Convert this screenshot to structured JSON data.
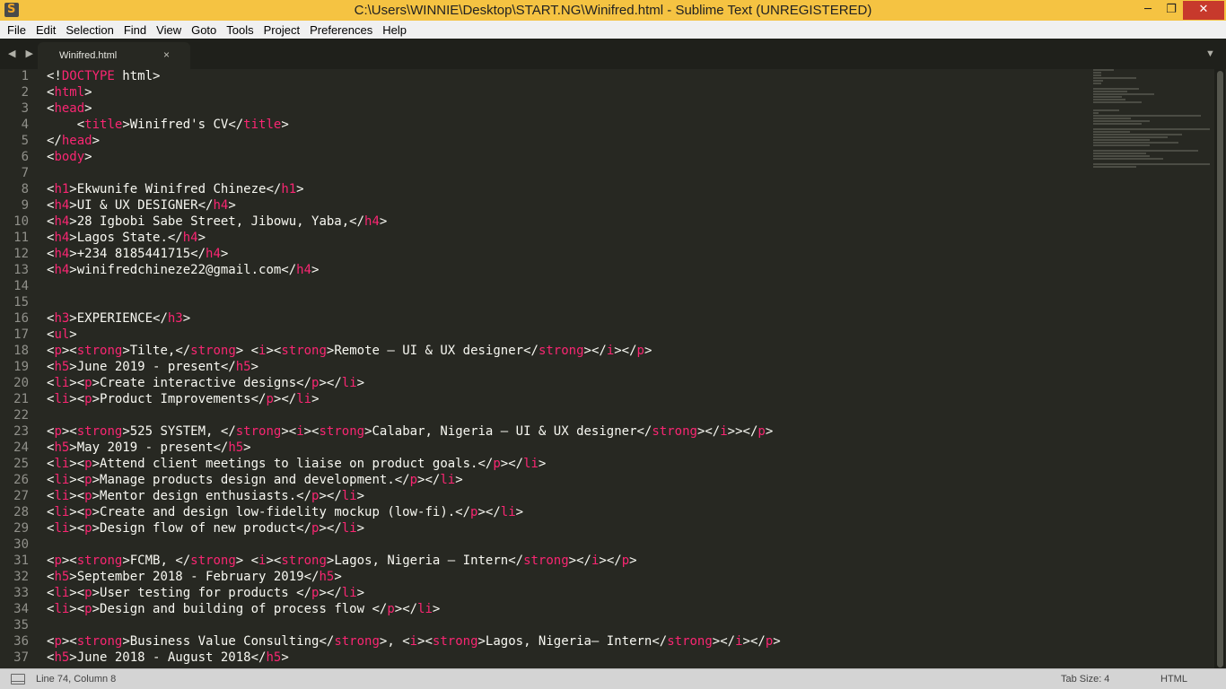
{
  "window": {
    "title": "C:\\Users\\WINNIE\\Desktop\\START.NG\\Winifred.html - Sublime Text (UNREGISTERED)",
    "minimize": "─",
    "maximize": "❐",
    "close": "✕"
  },
  "menu": [
    "File",
    "Edit",
    "Selection",
    "Find",
    "View",
    "Goto",
    "Tools",
    "Project",
    "Preferences",
    "Help"
  ],
  "tabs": {
    "nav_arrows": "◀ ▶",
    "active": "Winifred.html",
    "close": "×",
    "dropdown": "▼"
  },
  "colors": {
    "tag": "#f92672",
    "text": "#f8f8f2",
    "background": "#272822",
    "line_number": "#90908a",
    "title_bar": "#f5c342"
  },
  "editor": {
    "lines": [
      {
        "n": "1",
        "html": "&lt;!<span class=\"tag\">DOCTYPE</span> html&gt;"
      },
      {
        "n": "2",
        "html": "&lt;<span class=\"tag\">html</span>&gt;"
      },
      {
        "n": "3",
        "html": "&lt;<span class=\"tag\">head</span>&gt;"
      },
      {
        "n": "4",
        "html": "    &lt;<span class=\"tag\">title</span>&gt;Winifred's CV&lt;/<span class=\"tag\">title</span>&gt;"
      },
      {
        "n": "5",
        "html": "&lt;/<span class=\"tag\">head</span>&gt;"
      },
      {
        "n": "6",
        "html": "&lt;<span class=\"tag\">body</span>&gt;"
      },
      {
        "n": "7",
        "html": ""
      },
      {
        "n": "8",
        "html": "&lt;<span class=\"tag\">h1</span>&gt;Ekwunife Winifred Chineze&lt;/<span class=\"tag\">h1</span>&gt;"
      },
      {
        "n": "9",
        "html": "&lt;<span class=\"tag\">h4</span>&gt;UI &amp; UX DESIGNER&lt;/<span class=\"tag\">h4</span>&gt;"
      },
      {
        "n": "10",
        "html": "&lt;<span class=\"tag\">h4</span>&gt;28 Igbobi Sabe Street, Jibowu, Yaba,&lt;/<span class=\"tag\">h4</span>&gt;"
      },
      {
        "n": "11",
        "html": "&lt;<span class=\"tag\">h4</span>&gt;Lagos State.&lt;/<span class=\"tag\">h4</span>&gt;"
      },
      {
        "n": "12",
        "html": "&lt;<span class=\"tag\">h4</span>&gt;+234 8185441715&lt;/<span class=\"tag\">h4</span>&gt;"
      },
      {
        "n": "13",
        "html": "&lt;<span class=\"tag\">h4</span>&gt;winifredchineze22@gmail.com&lt;/<span class=\"tag\">h4</span>&gt;"
      },
      {
        "n": "14",
        "html": ""
      },
      {
        "n": "15",
        "html": ""
      },
      {
        "n": "16",
        "html": "&lt;<span class=\"tag\">h3</span>&gt;EXPERIENCE&lt;/<span class=\"tag\">h3</span>&gt;"
      },
      {
        "n": "17",
        "html": "&lt;<span class=\"tag\">ul</span>&gt;"
      },
      {
        "n": "18",
        "html": "&lt;<span class=\"tag\">p</span>&gt;&lt;<span class=\"tag\">strong</span>&gt;Tilte,&lt;/<span class=\"tag\">strong</span>&gt; &lt;<span class=\"tag\">i</span>&gt;&lt;<span class=\"tag\">strong</span>&gt;Remote — UI &amp; UX designer&lt;/<span class=\"tag\">strong</span>&gt;&lt;/<span class=\"tag\">i</span>&gt;&lt;/<span class=\"tag\">p</span>&gt;"
      },
      {
        "n": "19",
        "html": "&lt;<span class=\"tag\">h5</span>&gt;June 2019 - present&lt;/<span class=\"tag\">h5</span>&gt;"
      },
      {
        "n": "20",
        "html": "&lt;<span class=\"tag\">li</span>&gt;&lt;<span class=\"tag\">p</span>&gt;Create interactive designs&lt;/<span class=\"tag\">p</span>&gt;&lt;/<span class=\"tag\">li</span>&gt;"
      },
      {
        "n": "21",
        "html": "&lt;<span class=\"tag\">li</span>&gt;&lt;<span class=\"tag\">p</span>&gt;Product Improvements&lt;/<span class=\"tag\">p</span>&gt;&lt;/<span class=\"tag\">li</span>&gt;"
      },
      {
        "n": "22",
        "html": ""
      },
      {
        "n": "23",
        "html": "&lt;<span class=\"tag\">p</span>&gt;&lt;<span class=\"tag\">strong</span>&gt;525 SYSTEM, &lt;/<span class=\"tag\">strong</span>&gt;&lt;<span class=\"tag\">i</span>&gt;&lt;<span class=\"tag\">strong</span>&gt;Calabar, Nigeria — UI &amp; UX designer&lt;/<span class=\"tag\">strong</span>&gt;&lt;/<span class=\"tag\">i</span>&gt;&gt;&lt;/<span class=\"tag\">p</span>&gt;"
      },
      {
        "n": "24",
        "html": "&lt;<span class=\"tag\">h5</span>&gt;May 2019 - present&lt;/<span class=\"tag\">h5</span>&gt;"
      },
      {
        "n": "25",
        "html": "&lt;<span class=\"tag\">li</span>&gt;&lt;<span class=\"tag\">p</span>&gt;Attend client meetings to liaise on product goals.&lt;/<span class=\"tag\">p</span>&gt;&lt;/<span class=\"tag\">li</span>&gt;"
      },
      {
        "n": "26",
        "html": "&lt;<span class=\"tag\">li</span>&gt;&lt;<span class=\"tag\">p</span>&gt;Manage products design and development.&lt;/<span class=\"tag\">p</span>&gt;&lt;/<span class=\"tag\">li</span>&gt;"
      },
      {
        "n": "27",
        "html": "&lt;<span class=\"tag\">li</span>&gt;&lt;<span class=\"tag\">p</span>&gt;Mentor design enthusiasts.&lt;/<span class=\"tag\">p</span>&gt;&lt;/<span class=\"tag\">li</span>&gt;"
      },
      {
        "n": "28",
        "html": "&lt;<span class=\"tag\">li</span>&gt;&lt;<span class=\"tag\">p</span>&gt;Create and design low-fidelity mockup (low-fi).&lt;/<span class=\"tag\">p</span>&gt;&lt;/<span class=\"tag\">li</span>&gt;"
      },
      {
        "n": "29",
        "html": "&lt;<span class=\"tag\">li</span>&gt;&lt;<span class=\"tag\">p</span>&gt;Design flow of new product&lt;/<span class=\"tag\">p</span>&gt;&lt;/<span class=\"tag\">li</span>&gt;"
      },
      {
        "n": "30",
        "html": ""
      },
      {
        "n": "31",
        "html": "&lt;<span class=\"tag\">p</span>&gt;&lt;<span class=\"tag\">strong</span>&gt;FCMB, &lt;/<span class=\"tag\">strong</span>&gt; &lt;<span class=\"tag\">i</span>&gt;&lt;<span class=\"tag\">strong</span>&gt;Lagos, Nigeria — Intern&lt;/<span class=\"tag\">strong</span>&gt;&lt;/<span class=\"tag\">i</span>&gt;&lt;/<span class=\"tag\">p</span>&gt;"
      },
      {
        "n": "32",
        "html": "&lt;<span class=\"tag\">h5</span>&gt;September 2018 - February 2019&lt;/<span class=\"tag\">h5</span>&gt;"
      },
      {
        "n": "33",
        "html": "&lt;<span class=\"tag\">li</span>&gt;&lt;<span class=\"tag\">p</span>&gt;User testing for products &lt;/<span class=\"tag\">p</span>&gt;&lt;/<span class=\"tag\">li</span>&gt;"
      },
      {
        "n": "34",
        "html": "&lt;<span class=\"tag\">li</span>&gt;&lt;<span class=\"tag\">p</span>&gt;Design and building of process flow &lt;/<span class=\"tag\">p</span>&gt;&lt;/<span class=\"tag\">li</span>&gt;"
      },
      {
        "n": "35",
        "html": ""
      },
      {
        "n": "36",
        "html": "&lt;<span class=\"tag\">p</span>&gt;&lt;<span class=\"tag\">strong</span>&gt;Business Value Consulting&lt;/<span class=\"tag\">strong</span>&gt;, &lt;<span class=\"tag\">i</span>&gt;&lt;<span class=\"tag\">strong</span>&gt;Lagos, Nigeria— Intern&lt;/<span class=\"tag\">strong</span>&gt;&lt;/<span class=\"tag\">i</span>&gt;&lt;/<span class=\"tag\">p</span>&gt;"
      },
      {
        "n": "37",
        "html": "&lt;<span class=\"tag\">h5</span>&gt;June 2018 - August 2018&lt;/<span class=\"tag\">h5</span>&gt;"
      }
    ]
  },
  "status": {
    "position": "Line 74, Column 8",
    "tab_size": "Tab Size: 4",
    "syntax": "HTML"
  }
}
